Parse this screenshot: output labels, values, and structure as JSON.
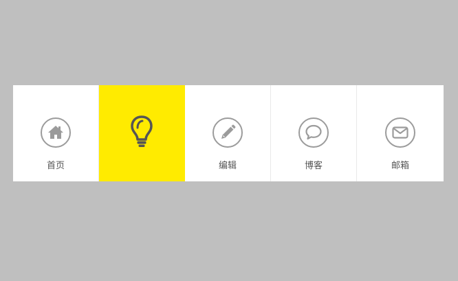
{
  "nav": {
    "items": [
      {
        "label": "首页",
        "icon": "home-icon",
        "active": false
      },
      {
        "label": "",
        "icon": "lightbulb-icon",
        "active": true
      },
      {
        "label": "编辑",
        "icon": "pencil-icon",
        "active": false
      },
      {
        "label": "博客",
        "icon": "chat-bubble-icon",
        "active": false
      },
      {
        "label": "邮箱",
        "icon": "envelope-icon",
        "active": false
      }
    ]
  },
  "colors": {
    "page_background": "#bfbfbf",
    "bar_background": "#ffffff",
    "active_background": "#ffeb00",
    "icon_gray": "#9b9b9b",
    "active_icon": "#555555",
    "label_text": "#555555"
  }
}
